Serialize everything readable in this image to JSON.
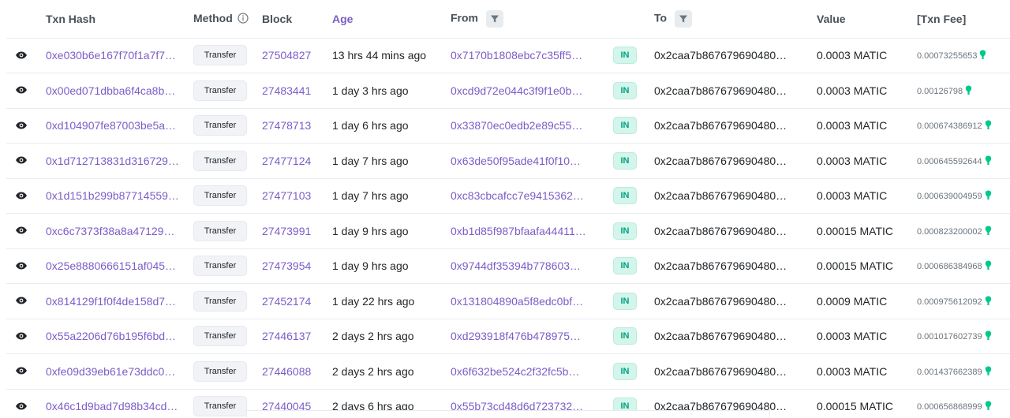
{
  "header": {
    "txn_hash": "Txn Hash",
    "method": "Method",
    "block": "Block",
    "age": "Age",
    "from": "From",
    "to": "To",
    "value": "Value",
    "txn_fee": "[Txn Fee]"
  },
  "colors": {
    "link": "#7b5dc8",
    "in_badge_bg": "#d4f5ea",
    "in_badge_text": "#00a186",
    "gas_icon": "#00c98b"
  },
  "icons": {
    "view": "eye-icon",
    "method_info": "info-icon",
    "filter": "filter-icon",
    "gas": "gas-icon"
  },
  "rows": [
    {
      "hash": "0xe030b6e167f70f1a7f7…",
      "method": "Transfer",
      "block": "27504827",
      "age": "13 hrs 44 mins ago",
      "from": "0x7170b1808ebc7c35ff5…",
      "direction": "IN",
      "to": "0x2caa7b867679690480…",
      "value": "0.0003 MATIC",
      "fee": "0.00073255653"
    },
    {
      "hash": "0x00ed071dbba6f4ca8b…",
      "method": "Transfer",
      "block": "27483441",
      "age": "1 day 3 hrs ago",
      "from": "0xcd9d72e044c3f9f1e0b…",
      "direction": "IN",
      "to": "0x2caa7b867679690480…",
      "value": "0.0003 MATIC",
      "fee": "0.00126798"
    },
    {
      "hash": "0xd104907fe87003be5a…",
      "method": "Transfer",
      "block": "27478713",
      "age": "1 day 6 hrs ago",
      "from": "0x33870ec0edb2e89c55…",
      "direction": "IN",
      "to": "0x2caa7b867679690480…",
      "value": "0.0003 MATIC",
      "fee": "0.000674386912"
    },
    {
      "hash": "0x1d712713831d316729…",
      "method": "Transfer",
      "block": "27477124",
      "age": "1 day 7 hrs ago",
      "from": "0x63de50f95ade41f0f10…",
      "direction": "IN",
      "to": "0x2caa7b867679690480…",
      "value": "0.0003 MATIC",
      "fee": "0.000645592644"
    },
    {
      "hash": "0x1d151b299b87714559…",
      "method": "Transfer",
      "block": "27477103",
      "age": "1 day 7 hrs ago",
      "from": "0xc83cbcafcc7e9415362…",
      "direction": "IN",
      "to": "0x2caa7b867679690480…",
      "value": "0.0003 MATIC",
      "fee": "0.000639004959"
    },
    {
      "hash": "0xc6c7373f38a8a47129…",
      "method": "Transfer",
      "block": "27473991",
      "age": "1 day 9 hrs ago",
      "from": "0xb1d85f987bfaafa44411…",
      "direction": "IN",
      "to": "0x2caa7b867679690480…",
      "value": "0.00015 MATIC",
      "fee": "0.000823200002"
    },
    {
      "hash": "0x25e8880666151af045…",
      "method": "Transfer",
      "block": "27473954",
      "age": "1 day 9 hrs ago",
      "from": "0x9744df35394b778603…",
      "direction": "IN",
      "to": "0x2caa7b867679690480…",
      "value": "0.00015 MATIC",
      "fee": "0.000686384968"
    },
    {
      "hash": "0x814129f1f0f4de158d7…",
      "method": "Transfer",
      "block": "27452174",
      "age": "1 day 22 hrs ago",
      "from": "0x131804890a5f8edc0bf…",
      "direction": "IN",
      "to": "0x2caa7b867679690480…",
      "value": "0.0009 MATIC",
      "fee": "0.000975612092"
    },
    {
      "hash": "0x55a2206d76b195f6bd…",
      "method": "Transfer",
      "block": "27446137",
      "age": "2 days 2 hrs ago",
      "from": "0xd293918f476b478975…",
      "direction": "IN",
      "to": "0x2caa7b867679690480…",
      "value": "0.0003 MATIC",
      "fee": "0.001017602739"
    },
    {
      "hash": "0xfe09d39eb61e73ddc0…",
      "method": "Transfer",
      "block": "27446088",
      "age": "2 days 2 hrs ago",
      "from": "0x6f632be524c2f32fc5b…",
      "direction": "IN",
      "to": "0x2caa7b867679690480…",
      "value": "0.0003 MATIC",
      "fee": "0.001437662389"
    },
    {
      "hash": "0x46c1d9bad7d98b34cd…",
      "method": "Transfer",
      "block": "27440045",
      "age": "2 days 6 hrs ago",
      "from": "0x55b73cd48d6d723732…",
      "direction": "IN",
      "to": "0x2caa7b867679690480…",
      "value": "0.00015 MATIC",
      "fee": "0.000656868999"
    }
  ]
}
